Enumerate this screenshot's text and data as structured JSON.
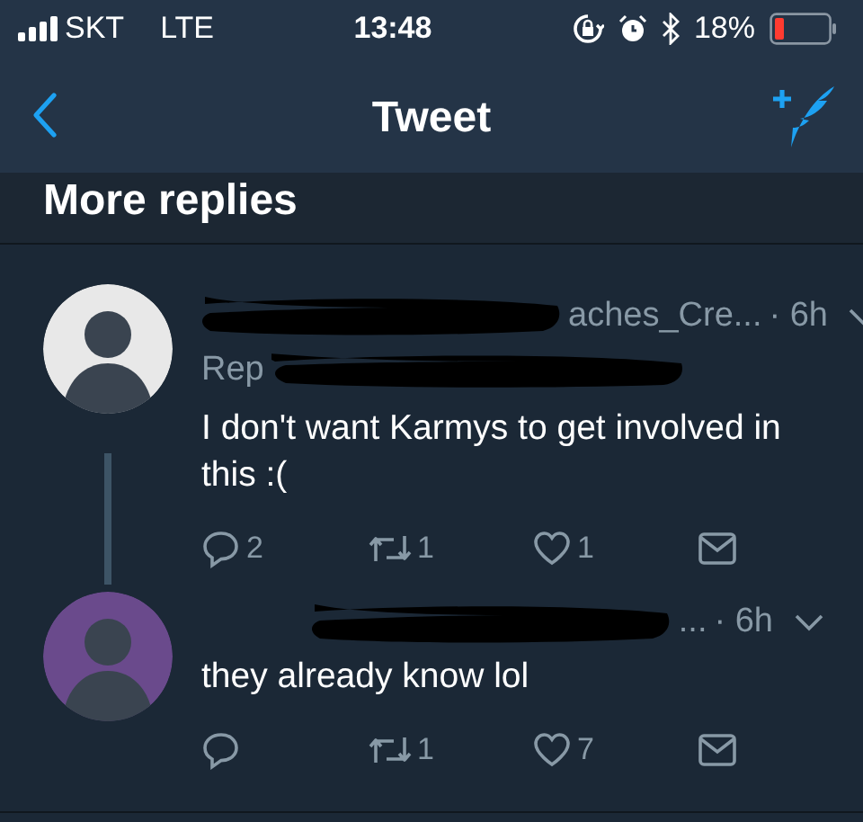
{
  "status_bar": {
    "carrier": "SKT",
    "network": "LTE",
    "time": "13:48",
    "battery": "18%"
  },
  "nav": {
    "title": "Tweet"
  },
  "section_title": "More replies",
  "tweets": [
    {
      "color": "#e8e8e8",
      "redacted": true,
      "thread_line": true,
      "handle": "aches_Cre...",
      "time": "· 6h",
      "reply_prefix": "Rep",
      "text": "I don't want Karmys to get involved in this :(",
      "counts": {
        "reply": "2",
        "retweet": "1",
        "like": "1"
      }
    },
    {
      "color": "#6a4a8c",
      "redacted": true,
      "thread_line": false,
      "handle": "...",
      "time": "· 6h",
      "text": "they already know lol",
      "counts": {
        "retweet": "1",
        "like": "7"
      }
    }
  ]
}
